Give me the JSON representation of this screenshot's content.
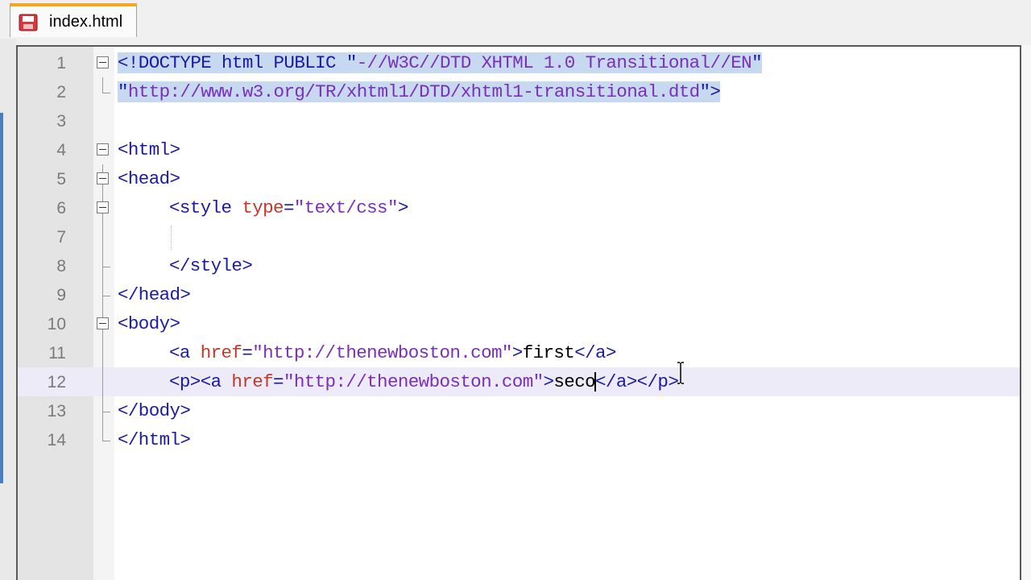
{
  "tab": {
    "label": "index.html"
  },
  "colors": {
    "tag": "#1a1aa6",
    "attribute": "#c0392b",
    "value": "#7a2fb8",
    "selection": "#c6d9f1",
    "current_line": "#ecebf7"
  },
  "lines": [
    {
      "num": "1",
      "p1": "<!DOCTYPE html PUBLIC \"",
      "p2": "-//W3C//DTD XHTML 1.0 Transitional//EN",
      "p3": "\""
    },
    {
      "num": "2",
      "p1": "\"",
      "p2": "http://www.w3.org/TR/xhtml1/DTD/xhtml1-transitional.dtd",
      "p3": "\">"
    },
    {
      "num": "3"
    },
    {
      "num": "4",
      "t1": "<html>"
    },
    {
      "num": "5",
      "t1": "<head>"
    },
    {
      "num": "6",
      "t1": "<style ",
      "a1": "type",
      "t2": "=",
      "v1": "\"text/css\"",
      "t3": ">"
    },
    {
      "num": "7"
    },
    {
      "num": "8",
      "t1": "</style>"
    },
    {
      "num": "9",
      "t1": "</head>"
    },
    {
      "num": "10",
      "t1": "<body>"
    },
    {
      "num": "11",
      "t1": "<a ",
      "a1": "href",
      "t2": "=",
      "v1": "\"http://thenewboston.com\"",
      "t3": ">",
      "x1": "first",
      "t4": "</a>"
    },
    {
      "num": "12",
      "t1": "<p><a ",
      "a1": "href",
      "t2": "=",
      "v1": "\"http://thenewboston.com\"",
      "t3": ">",
      "x1": "seco",
      "t4": "</a></p>"
    },
    {
      "num": "13",
      "t1": "</body>"
    },
    {
      "num": "14",
      "t1": "</html>"
    }
  ]
}
